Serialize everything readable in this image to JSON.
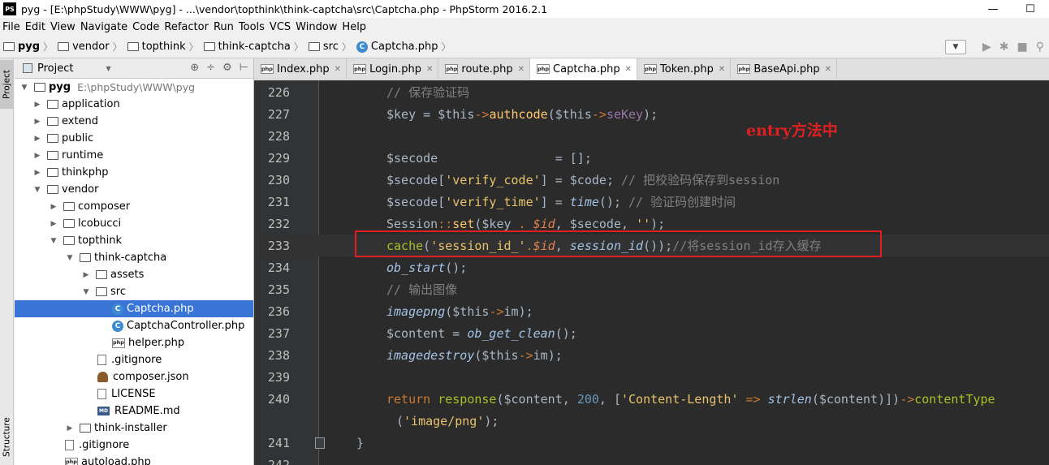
{
  "window": {
    "app_icon": "PS",
    "title": "pyg - [E:\\phpStudy\\WWW\\pyg] - ...\\vendor\\topthink\\think-captcha\\src\\Captcha.php - PhpStorm 2016.2.1",
    "minimize": "—",
    "maximize": "☐",
    "close": "✕"
  },
  "menu": [
    "File",
    "Edit",
    "View",
    "Navigate",
    "Code",
    "Refactor",
    "Run",
    "Tools",
    "VCS",
    "Window",
    "Help"
  ],
  "breadcrumbs": [
    "pyg",
    "vendor",
    "topthink",
    "think-captcha",
    "src",
    "Captcha.php"
  ],
  "left_strip": {
    "project": "Project",
    "structure": "Structure"
  },
  "project_panel": {
    "title": "Project",
    "root_name": "pyg",
    "root_path": "E:\\phpStudy\\WWW\\pyg",
    "tree": [
      {
        "label": "application"
      },
      {
        "label": "extend"
      },
      {
        "label": "public"
      },
      {
        "label": "runtime"
      },
      {
        "label": "thinkphp"
      },
      {
        "label": "vendor"
      },
      {
        "label": "composer"
      },
      {
        "label": "lcobucci"
      },
      {
        "label": "topthink"
      },
      {
        "label": "think-captcha"
      },
      {
        "label": "assets"
      },
      {
        "label": "src"
      },
      {
        "label": "Captcha.php"
      },
      {
        "label": "CaptchaController.php"
      },
      {
        "label": "helper.php"
      },
      {
        "label": ".gitignore"
      },
      {
        "label": "composer.json"
      },
      {
        "label": "LICENSE"
      },
      {
        "label": "README.md"
      },
      {
        "label": "think-installer"
      },
      {
        "label": ".gitignore"
      },
      {
        "label": "autoload.php"
      }
    ]
  },
  "tabs": [
    "Index.php",
    "Login.php",
    "route.php",
    "Captcha.php",
    "Token.php",
    "BaseApi.php"
  ],
  "editor": {
    "annotation": "entry方法中",
    "lines": [
      {
        "no": "226"
      },
      {
        "no": "227"
      },
      {
        "no": "228"
      },
      {
        "no": "229"
      },
      {
        "no": "230"
      },
      {
        "no": "231"
      },
      {
        "no": "232"
      },
      {
        "no": "233"
      },
      {
        "no": "234"
      },
      {
        "no": "235"
      },
      {
        "no": "236"
      },
      {
        "no": "237"
      },
      {
        "no": "238"
      },
      {
        "no": "239"
      },
      {
        "no": "240"
      },
      {
        "no": ""
      },
      {
        "no": "241"
      },
      {
        "no": "242"
      }
    ],
    "code": {
      "l226": "// 保存验证码",
      "l227_a": "$key",
      "l227_b": " = ",
      "l227_c": "$this",
      "l227_d": "->",
      "l227_e": "authcode",
      "l227_f": "(",
      "l227_g": "$this",
      "l227_h": "->",
      "l227_i": "seKey",
      "l227_j": ");",
      "l229_a": "$secode",
      "l229_b": "                = [];",
      "l230_a": "$secode",
      "l230_b": "[",
      "l230_c": "'verify_code'",
      "l230_d": "] = ",
      "l230_e": "$code",
      "l230_f": "; ",
      "l230_g": "// 把校验码保存到session",
      "l231_a": "$secode",
      "l231_b": "[",
      "l231_c": "'verify_time'",
      "l231_d": "] = ",
      "l231_e": "time",
      "l231_f": "(); ",
      "l231_g": "// 验证码创建时间",
      "l232_a": "Session",
      "l232_b": "::",
      "l232_c": "set",
      "l232_d": "(",
      "l232_e": "$key",
      "l232_f": " . ",
      "l232_g": "$id",
      "l232_h": ", ",
      "l232_i": "$secode",
      "l232_j": ", ",
      "l232_k": "''",
      "l232_l": ");",
      "l233_a": "cache",
      "l233_b": "(",
      "l233_c": "'session_id_'",
      "l233_d": ".",
      "l233_e": "$id",
      "l233_f": ", ",
      "l233_g": "session_id",
      "l233_h": "());",
      "l233_i": "//将session_id存入缓存",
      "l234_a": "ob_start",
      "l234_b": "();",
      "l235": "// 输出图像",
      "l236_a": "imagepng",
      "l236_b": "(",
      "l236_c": "$this",
      "l236_d": "->",
      "l236_e": "im",
      "l236_f": ");",
      "l237_a": "$content",
      "l237_b": " = ",
      "l237_c": "ob_get_clean",
      "l237_d": "();",
      "l238_a": "imagedestroy",
      "l238_b": "(",
      "l238_c": "$this",
      "l238_d": "->",
      "l238_e": "im",
      "l238_f": ");",
      "l240_a": "return ",
      "l240_b": "response",
      "l240_c": "(",
      "l240_d": "$content",
      "l240_e": ", ",
      "l240_f": "200",
      "l240_g": ", [",
      "l240_h": "'Content-Length'",
      "l240_i": " => ",
      "l240_j": "strlen",
      "l240_k": "(",
      "l240_l": "$content",
      "l240_m": ")])",
      "l240_n": "->",
      "l240_o": "contentType",
      "l240w_a": "(",
      "l240w_b": "'image/png'",
      "l240w_c": ");",
      "l241": "}"
    }
  }
}
